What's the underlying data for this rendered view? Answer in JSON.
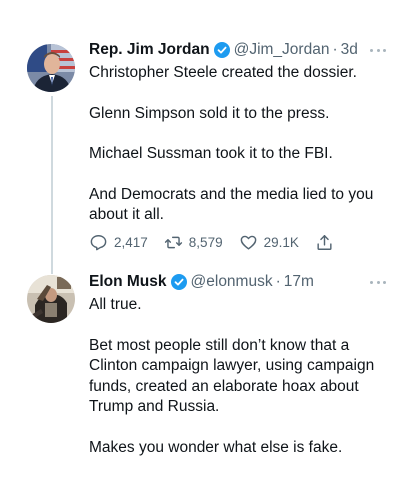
{
  "tweets": [
    {
      "author_name": "Rep. Jim Jordan",
      "handle": "@Jim_Jordan",
      "separator": "·",
      "time": "3d",
      "paragraphs": [
        "Christopher Steele created the dossier.",
        "Glenn Simpson sold it to the press.",
        "Michael Sussman took it to the FBI.",
        "And Democrats and the media lied to you about it all."
      ],
      "stats": {
        "replies": "2,417",
        "retweets": "8,579",
        "likes": "29.1K"
      },
      "avatar_icon": "congressman-portrait-avatar"
    },
    {
      "author_name": "Elon Musk",
      "handle": "@elonmusk",
      "separator": "·",
      "time": "17m",
      "paragraphs": [
        "All true.",
        "Bet most people still don’t know that a Clinton campaign lawyer, using campaign funds, created an elaborate hoax about Trump and Russia.",
        "Makes you wonder what else is fake."
      ],
      "avatar_icon": "elon-musk-avatar"
    }
  ],
  "colors": {
    "verified": "#1d9bf0",
    "secondary_text": "#536471",
    "primary_text": "#0f1419",
    "thread_line": "#cfd9de"
  },
  "icons": {
    "verified": "verified-badge-icon",
    "reply": "reply-icon",
    "retweet": "retweet-icon",
    "like": "heart-icon",
    "share": "share-icon",
    "more": "more-options-icon"
  }
}
